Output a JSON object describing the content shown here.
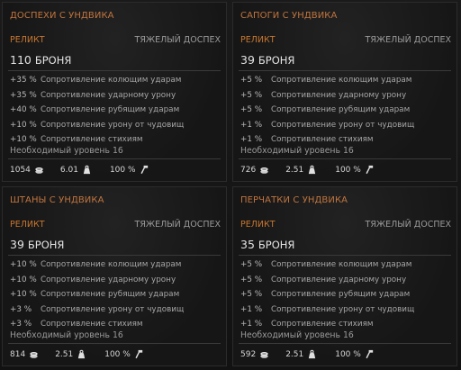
{
  "cards": [
    {
      "title": "ДОСПЕХИ С УНДВИКА",
      "rarity": "РЕЛИКТ",
      "armor_type": "ТЯЖЕЛЫЙ ДОСПЕХ",
      "armor_value": "110",
      "armor_label": "БРОНЯ",
      "stats": [
        {
          "value": "+35 %",
          "label": "Сопротивление колющим ударам"
        },
        {
          "value": "+35 %",
          "label": "Сопротивление ударному урону"
        },
        {
          "value": "+40 %",
          "label": "Сопротивление рубящим ударам"
        },
        {
          "value": "+10 %",
          "label": "Сопротивление урону от чудовищ"
        },
        {
          "value": "+10 %",
          "label": "Сопротивление стихиям"
        }
      ],
      "required_level": "Необходимый уровень 16",
      "price": "1054",
      "weight": "6.01",
      "durability": "100 %"
    },
    {
      "title": "САПОГИ С УНДВИКА",
      "rarity": "РЕЛИКТ",
      "armor_type": "ТЯЖЕЛЫЙ ДОСПЕХ",
      "armor_value": "39",
      "armor_label": "БРОНЯ",
      "stats": [
        {
          "value": "+5 %",
          "label": "Сопротивление колющим ударам"
        },
        {
          "value": "+5 %",
          "label": "Сопротивление ударному урону"
        },
        {
          "value": "+5 %",
          "label": "Сопротивление рубящим ударам"
        },
        {
          "value": "+1 %",
          "label": "Сопротивление урону от чудовищ"
        },
        {
          "value": "+1 %",
          "label": "Сопротивление стихиям"
        }
      ],
      "required_level": "Необходимый уровень 16",
      "price": "726",
      "weight": "2.51",
      "durability": "100 %"
    },
    {
      "title": "ШТАНЫ С УНДВИКА",
      "rarity": "РЕЛИКТ",
      "armor_type": "ТЯЖЕЛЫЙ ДОСПЕХ",
      "armor_value": "39",
      "armor_label": "БРОНЯ",
      "stats": [
        {
          "value": "+10 %",
          "label": "Сопротивление колющим ударам"
        },
        {
          "value": "+10 %",
          "label": "Сопротивление ударному урону"
        },
        {
          "value": "+10 %",
          "label": "Сопротивление рубящим ударам"
        },
        {
          "value": "+3 %",
          "label": "Сопротивление урону от чудовищ"
        },
        {
          "value": "+3 %",
          "label": "Сопротивление стихиям"
        }
      ],
      "required_level": "Необходимый уровень 16",
      "price": "814",
      "weight": "2.51",
      "durability": "100 %"
    },
    {
      "title": "ПЕРЧАТКИ С УНДВИКА",
      "rarity": "РЕЛИКТ",
      "armor_type": "ТЯЖЕЛЫЙ ДОСПЕХ",
      "armor_value": "35",
      "armor_label": "БРОНЯ",
      "stats": [
        {
          "value": "+5 %",
          "label": "Сопротивление колющим ударам"
        },
        {
          "value": "+5 %",
          "label": "Сопротивление ударному урону"
        },
        {
          "value": "+5 %",
          "label": "Сопротивление рубящим ударам"
        },
        {
          "value": "+1 %",
          "label": "Сопротивление урону от чудовищ"
        },
        {
          "value": "+1 %",
          "label": "Сопротивление стихиям"
        }
      ],
      "required_level": "Необходимый уровень 16",
      "price": "592",
      "weight": "2.51",
      "durability": "100 %"
    }
  ],
  "icons": {
    "price": "coins-icon",
    "weight": "weight-icon",
    "durability": "hammer-icon"
  },
  "colors": {
    "title": "#c0743e",
    "rarity": "#c8762e"
  }
}
